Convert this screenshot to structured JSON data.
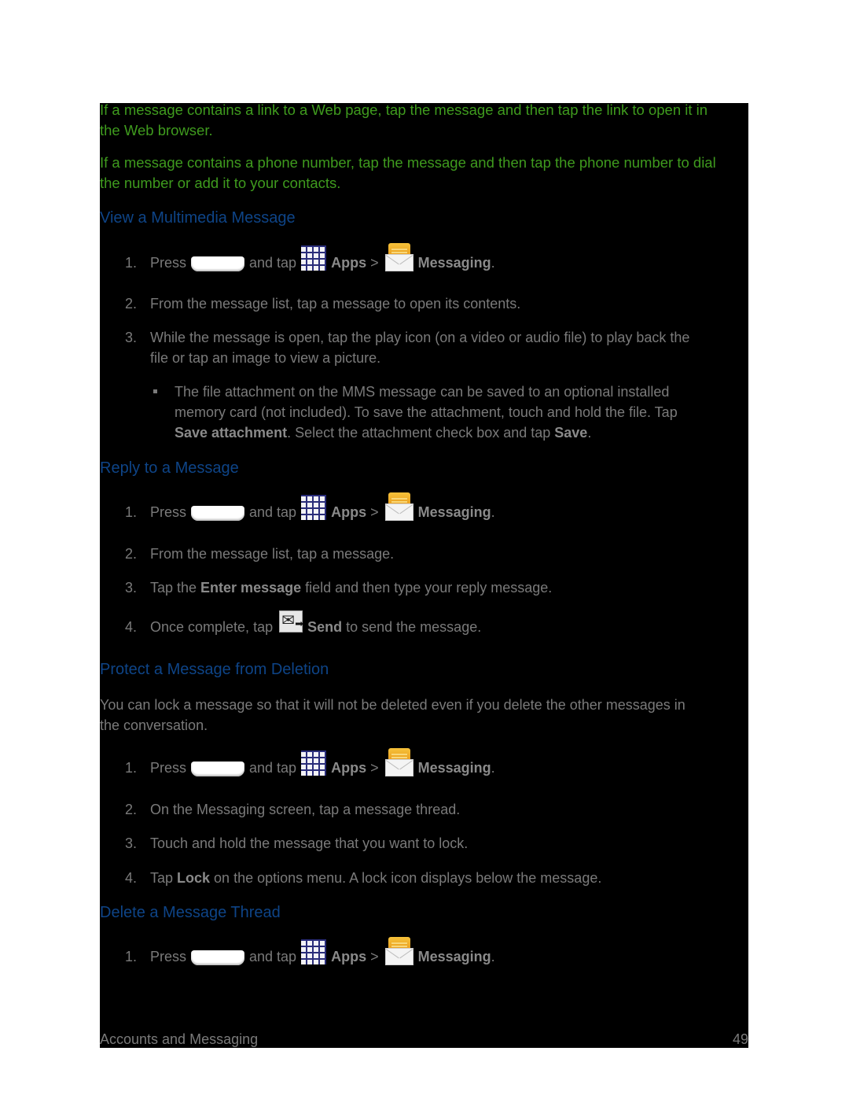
{
  "intro": [
    [
      "If a message contains a link to a Web page, tap the message and then tap the link to open it in",
      "the Web browser."
    ],
    [
      "If a message contains a phone number, tap the message and then tap the phone number to dial",
      "the number or add it to your contacts."
    ]
  ],
  "common": {
    "press": "Press",
    "and_tap": "and tap",
    "apps": "Apps",
    "gt": ">",
    "messaging": "Messaging",
    "period": ".",
    "icons": {
      "home": "home-button-icon",
      "apps": "apps-grid-icon",
      "messaging": "messaging-envelope-icon",
      "send": "send-icon"
    }
  },
  "sections": {
    "view_mms": {
      "title": "View a Multimedia Message",
      "steps": [
        {
          "num": "1."
        },
        {
          "num": "2.",
          "text": "From the message list, tap a message to open its contents."
        },
        {
          "num": "3.",
          "lines": [
            "While the message is open, tap the play icon (on a video or audio file) to play back the",
            "file or tap an image to view a picture."
          ]
        }
      ],
      "note": {
        "line1": "The file attachment on the MMS message can be saved to an optional installed",
        "line2": "memory card (not included). To save the attachment, touch and hold the file. Tap",
        "bold1": "Save attachment",
        "mid": ". Select the attachment check box and tap ",
        "bold2": "Save",
        "end": "."
      }
    },
    "reply": {
      "title": "Reply to a Message",
      "steps": [
        {
          "num": "1."
        },
        {
          "num": "2.",
          "text": "From the message list, tap a message."
        },
        {
          "num": "3.",
          "pre": "Tap the ",
          "bold": "Enter message",
          "post": " field and then type your reply message."
        },
        {
          "num": "4.",
          "pre": "Once complete, tap",
          "bold": "Send",
          "post": " to send the message."
        }
      ]
    },
    "protect": {
      "title": "Protect a Message from Deletion",
      "intro": [
        "You can lock a message so that it will not be deleted even if you delete the other messages in",
        "the conversation."
      ],
      "steps": [
        {
          "num": "1."
        },
        {
          "num": "2.",
          "text": "On the Messaging screen, tap a message thread."
        },
        {
          "num": "3.",
          "text": "Touch and hold the message that you want to lock."
        },
        {
          "num": "4.",
          "pre": "Tap ",
          "bold": "Lock",
          "post": " on the options menu. A lock icon displays below the message."
        }
      ]
    },
    "delete": {
      "title": "Delete a Message Thread",
      "steps": [
        {
          "num": "1."
        }
      ]
    }
  },
  "footer": {
    "section": "Accounts and Messaging",
    "page": "49"
  }
}
